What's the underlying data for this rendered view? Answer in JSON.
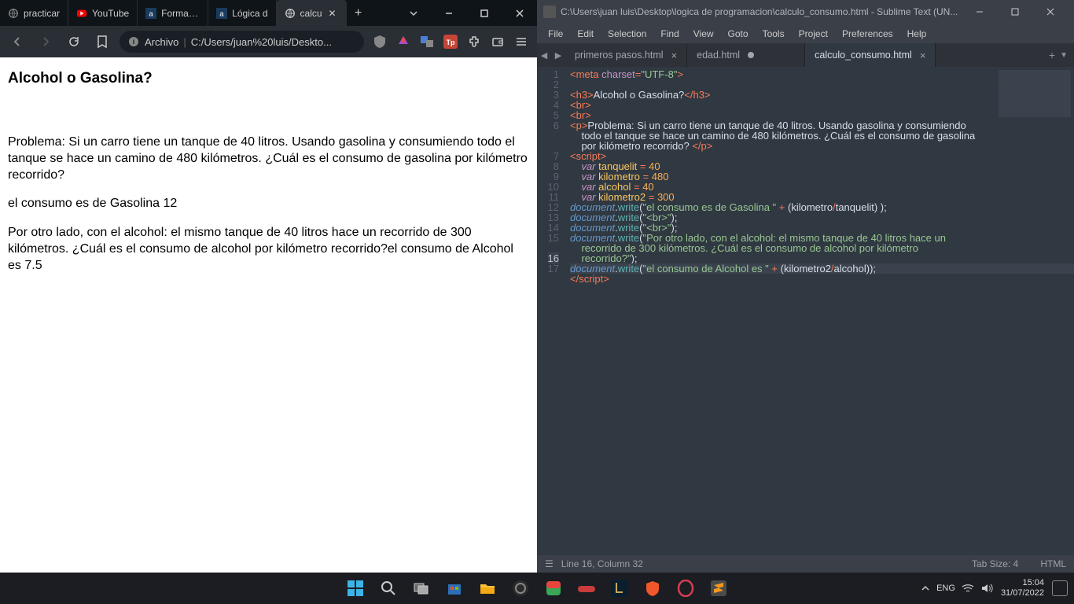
{
  "browser": {
    "tabs": [
      {
        "label": "practicar",
        "favicon": "globe"
      },
      {
        "label": "YouTube",
        "favicon": "yt"
      },
      {
        "label": "Formació",
        "favicon": "a"
      },
      {
        "label": "Lógica d",
        "favicon": "a"
      },
      {
        "label": "calcu",
        "favicon": "globe",
        "active": true
      }
    ],
    "addr_label": "Archivo",
    "addr_url": "C:/Users/juan%20luis/Deskto...",
    "page": {
      "title": "Alcohol o Gasolina?",
      "p1": "Problema: Si un carro tiene un tanque de 40 litros. Usando gasolina y consumiendo todo el tanque se hace un camino de 480 kilómetros. ¿Cuál es el consumo de gasolina por kilómetro recorrido?",
      "p2": "el consumo es de Gasolina 12",
      "p3": "Por otro lado, con el alcohol: el mismo tanque de 40 litros hace un recorrido de 300 kilómetros. ¿Cuál es el consumo de alcohol por kilómetro recorrido?el consumo de Alcohol es 7.5"
    }
  },
  "sublime": {
    "title": "C:\\Users\\juan luis\\Desktop\\logica de programacion\\calculo_consumo.html - Sublime Text (UN...",
    "menu": [
      "File",
      "Edit",
      "Selection",
      "Find",
      "View",
      "Goto",
      "Tools",
      "Project",
      "Preferences",
      "Help"
    ],
    "tabs": [
      {
        "label": "primeros pasos.html",
        "close": true
      },
      {
        "label": "edad.html",
        "dirty": true
      },
      {
        "label": "calculo_consumo.html",
        "active": true,
        "close": true
      }
    ],
    "code_text": {
      "h3_text": "Alcohol o Gasolina?",
      "p_text": "Problema: Si un carro tiene un tanque de 40 litros. Usando gasolina y consumiendo todo el tanque se hace un camino de 480 kilómetros. ¿Cuál es el consumo de gasolina por kilómetro recorrido? ",
      "tanquelit": "40",
      "kilometro": "480",
      "alcohol": "40",
      "kilometro2": "300",
      "str1": "\"el consumo es de Gasolina \"",
      "str_br": "\"<br>\"",
      "str2": "\"Por otro lado, con el alcohol: el mismo tanque de 40 litros hace un recorrido de 300 kilómetros. ¿Cuál es el consumo de alcohol por kilómetro recorrido?\"",
      "str3": "\"el consumo de Alcohol es \""
    },
    "status_left": "Line 16, Column 32",
    "tabsize": "Tab Size: 4",
    "syntax": "HTML"
  },
  "taskbar": {
    "lang": "ENG",
    "time": "15:04",
    "date": "31/07/2022"
  }
}
